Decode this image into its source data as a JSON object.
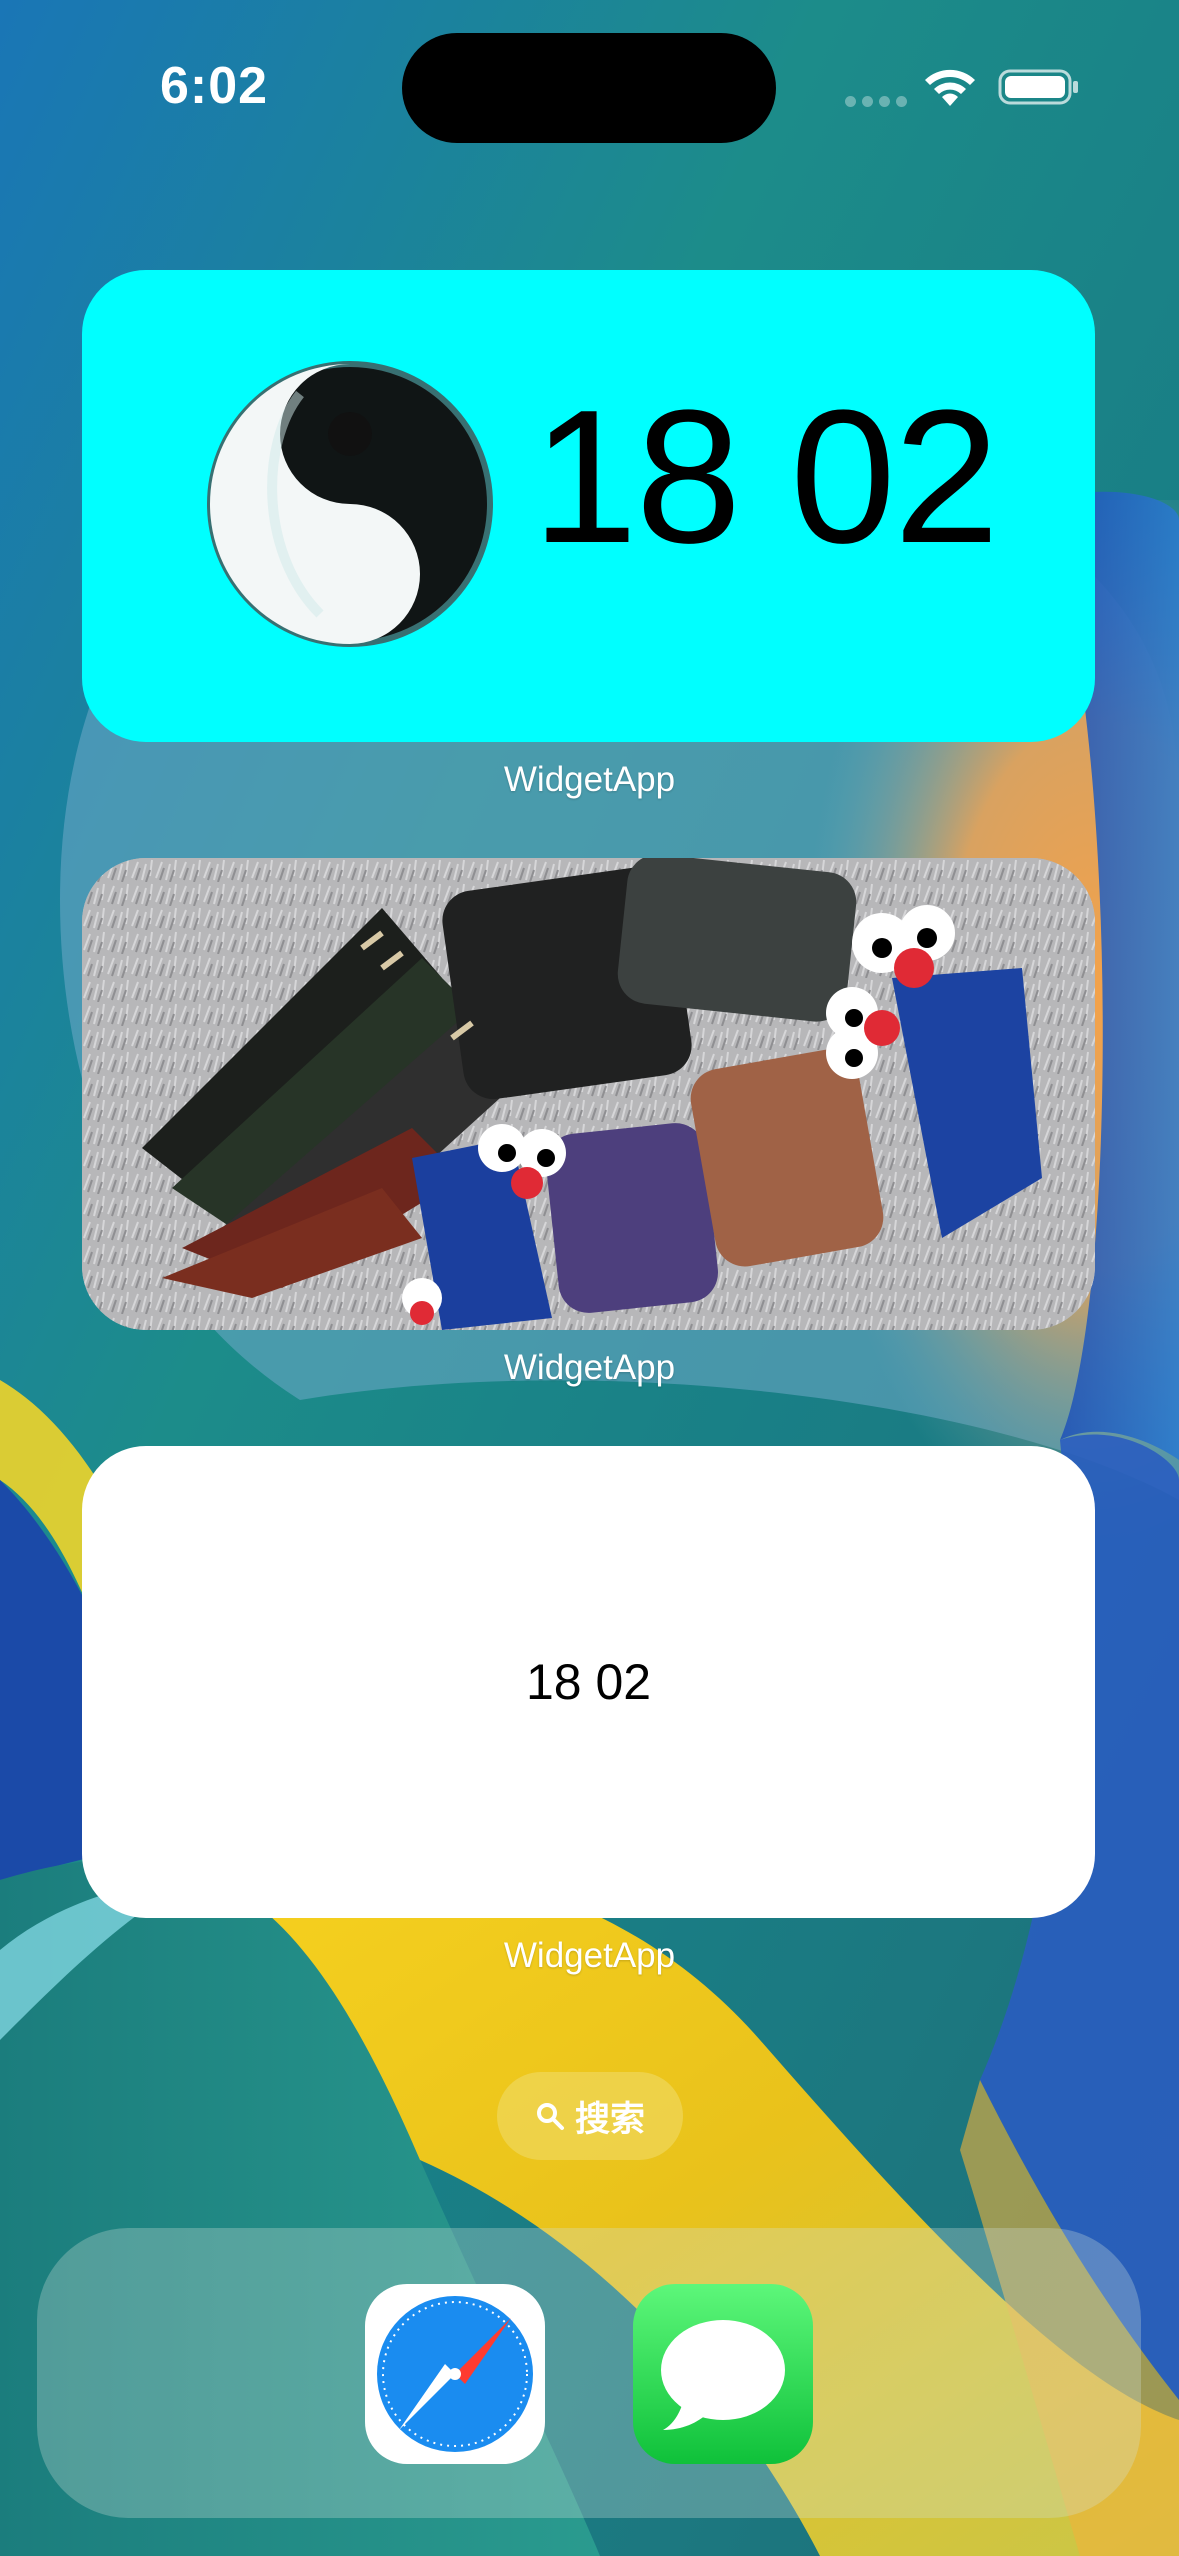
{
  "status_bar": {
    "time": "6:02"
  },
  "widgets": [
    {
      "kind": "yin-yang-clock",
      "time_text": "18 02",
      "background": "#00ffff",
      "app_label": "WidgetApp"
    },
    {
      "kind": "photo",
      "app_label": "WidgetApp"
    },
    {
      "kind": "plain-clock",
      "time_text": "18 02",
      "background": "#ffffff",
      "app_label": "WidgetApp"
    }
  ],
  "search": {
    "label": "搜索",
    "icon": "search-icon"
  },
  "dock": {
    "apps": [
      {
        "name": "Safari",
        "icon": "safari-icon"
      },
      {
        "name": "Messages",
        "icon": "messages-icon"
      }
    ]
  },
  "colors": {
    "accent_cyan": "#00ffff",
    "wallpaper_blue": "#1b6fa8",
    "wallpaper_yellow": "#f3c81c",
    "wallpaper_orange": "#f1a34d",
    "messages_green": "#22d044",
    "safari_blue": "#1a8cf0"
  }
}
